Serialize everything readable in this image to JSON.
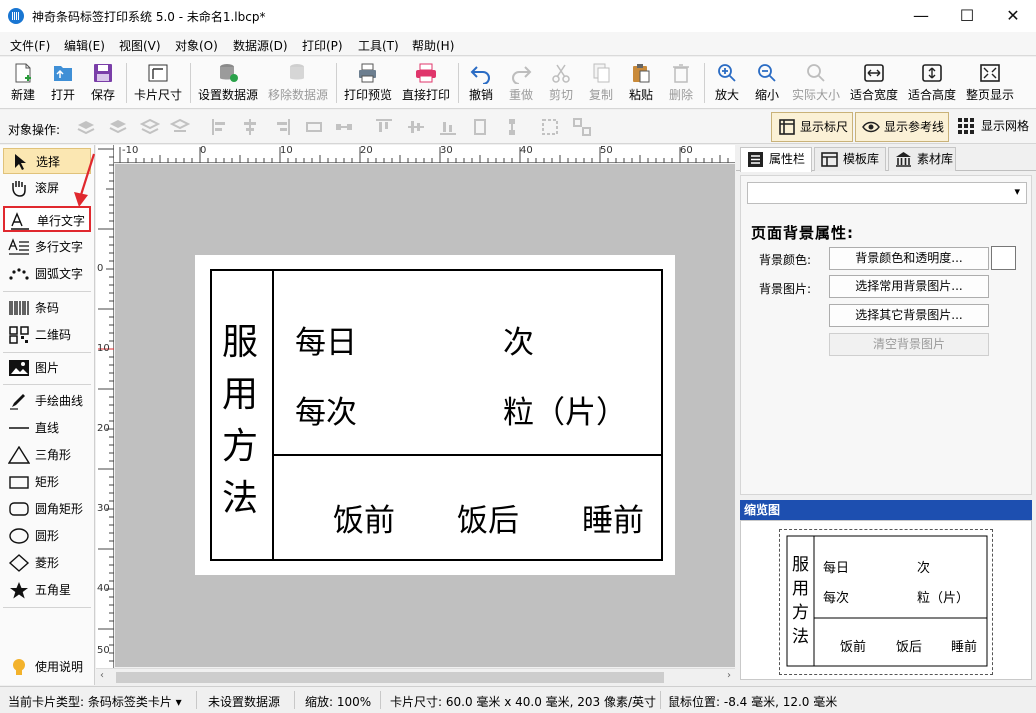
{
  "window": {
    "title": "神奇条码标签打印系统 5.0 - 未命名1.lbcp*",
    "minimize_glyph": "—",
    "maximize_glyph": "☐",
    "close_glyph": "✕"
  },
  "menu": [
    "文件(F)",
    "编辑(E)",
    "视图(V)",
    "对象(O)",
    "数据源(D)",
    "打印(P)",
    "工具(T)",
    "帮助(H)"
  ],
  "toolbar": {
    "new": "新建",
    "open": "打开",
    "save": "保存",
    "card_size": "卡片尺寸",
    "set_datasource": "设置数据源",
    "remove_datasource": "移除数据源",
    "print_preview": "打印预览",
    "direct_print": "直接打印",
    "undo": "撤销",
    "redo": "重做",
    "cut": "剪切",
    "copy": "复制",
    "paste": "粘贴",
    "delete": "删除",
    "zoom_in": "放大",
    "zoom_out": "缩小",
    "actual_size": "实际大小",
    "fit_width": "适合宽度",
    "fit_height": "适合高度",
    "whole_page": "整页显示"
  },
  "objbar": {
    "label": "对象操作:",
    "show_ruler": "显示标尺",
    "show_guides": "显示参考线",
    "show_grid": "显示网格"
  },
  "tools": {
    "select": "选择",
    "scroll": "滚屏",
    "single_text": "单行文字",
    "multi_text": "多行文字",
    "arc_text": "圆弧文字",
    "barcode": "条码",
    "qrcode": "二维码",
    "image": "图片",
    "freehand": "手绘曲线",
    "line": "直线",
    "triangle": "三角形",
    "rect": "矩形",
    "round_rect": "圆角矩形",
    "ellipse": "圆形",
    "diamond": "菱形",
    "star": "五角星",
    "help": "使用说明"
  },
  "ruler": {
    "h_labels": [
      "-10",
      "0",
      "10",
      "20",
      "30",
      "40",
      "50",
      "60"
    ],
    "v_labels": [
      "0",
      "10",
      "20",
      "30",
      "40",
      "50"
    ]
  },
  "label": {
    "vertical_chars": [
      "服",
      "用",
      "方",
      "法"
    ],
    "daily": "每日",
    "times": "次",
    "each": "每次",
    "pills": "粒（片）",
    "before_meal": "饭前",
    "after_meal": "饭后",
    "before_sleep": "睡前"
  },
  "right_tabs": {
    "properties": "属性栏",
    "templates": "模板库",
    "materials": "素材库"
  },
  "properties": {
    "title": "页面背景属性:",
    "bg_color_label": "背景颜色:",
    "bg_color_button": "背景颜色和透明度...",
    "bg_image_label": "背景图片:",
    "common_bg_button": "选择常用背景图片...",
    "other_bg_button": "选择其它背景图片...",
    "clear_bg_button": "清空背景图片"
  },
  "preview": {
    "title": "缩览图"
  },
  "status": {
    "card_type": "当前卡片类型: 条码标签类卡片 ▾",
    "datasource": "未设置数据源",
    "zoom": "缩放: 100%",
    "card_size": "卡片尺寸: 60.0 毫米 x 40.0 毫米, 203 像素/英寸",
    "mouse_pos": "鼠标位置: -8.4 毫米, 12.0 毫米"
  },
  "colors": {
    "accent": "#1d4fb0",
    "selected_tool": "#fbe7b2",
    "highlight_box": "#e0282e",
    "canvas_bg": "#c0c0c0"
  }
}
